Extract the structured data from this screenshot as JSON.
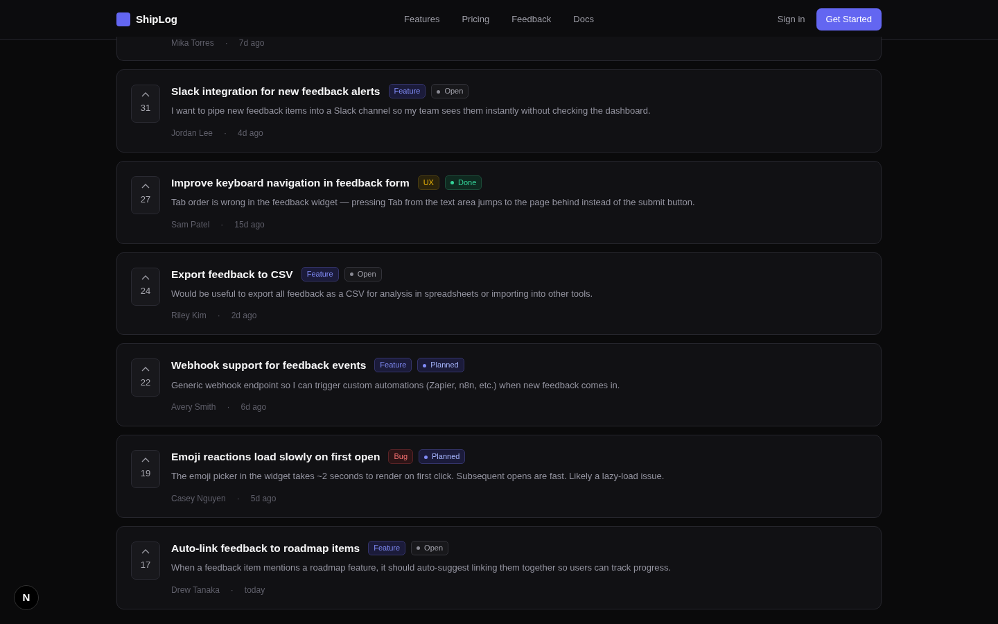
{
  "navbar": {
    "brand": "ShipLog",
    "links": [
      "Features",
      "Pricing",
      "Feedback",
      "Docs"
    ],
    "sign_in": "Sign in",
    "cta": "Get Started"
  },
  "partial_item": {
    "author": "Mika Torres",
    "separator": "·",
    "time": "7d ago"
  },
  "items": [
    {
      "votes": "31",
      "title": "Slack integration for new feedback alerts",
      "tag": {
        "label": "Feature",
        "kind": "feature"
      },
      "status": {
        "label": "Open",
        "kind": "open"
      },
      "description": "I want to pipe new feedback items into a Slack channel so my team sees them instantly without checking the dashboard.",
      "author": "Jordan Lee",
      "separator": "·",
      "time": "4d ago"
    },
    {
      "votes": "27",
      "title": "Improve keyboard navigation in feedback form",
      "tag": {
        "label": "UX",
        "kind": "ux"
      },
      "status": {
        "label": "Done",
        "kind": "done"
      },
      "description": "Tab order is wrong in the feedback widget — pressing Tab from the text area jumps to the page behind instead of the submit button.",
      "author": "Sam Patel",
      "separator": "·",
      "time": "15d ago"
    },
    {
      "votes": "24",
      "title": "Export feedback to CSV",
      "tag": {
        "label": "Feature",
        "kind": "feature"
      },
      "status": {
        "label": "Open",
        "kind": "open"
      },
      "description": "Would be useful to export all feedback as a CSV for analysis in spreadsheets or importing into other tools.",
      "author": "Riley Kim",
      "separator": "·",
      "time": "2d ago"
    },
    {
      "votes": "22",
      "title": "Webhook support for feedback events",
      "tag": {
        "label": "Feature",
        "kind": "feature"
      },
      "status": {
        "label": "Planned",
        "kind": "planned"
      },
      "description": "Generic webhook endpoint so I can trigger custom automations (Zapier, n8n, etc.) when new feedback comes in.",
      "author": "Avery Smith",
      "separator": "·",
      "time": "6d ago"
    },
    {
      "votes": "19",
      "title": "Emoji reactions load slowly on first open",
      "tag": {
        "label": "Bug",
        "kind": "bug"
      },
      "status": {
        "label": "Planned",
        "kind": "planned"
      },
      "description": "The emoji picker in the widget takes ~2 seconds to render on first click. Subsequent opens are fast. Likely a lazy-load issue.",
      "author": "Casey Nguyen",
      "separator": "·",
      "time": "5d ago"
    },
    {
      "votes": "17",
      "title": "Auto-link feedback to roadmap items",
      "tag": {
        "label": "Feature",
        "kind": "feature"
      },
      "status": {
        "label": "Open",
        "kind": "open"
      },
      "description": "When a feedback item mentions a roadmap feature, it should auto-suggest linking them together so users can track progress.",
      "author": "Drew Tanaka",
      "separator": "·",
      "time": "today"
    }
  ],
  "dev_indicator": {
    "letter": "N"
  }
}
